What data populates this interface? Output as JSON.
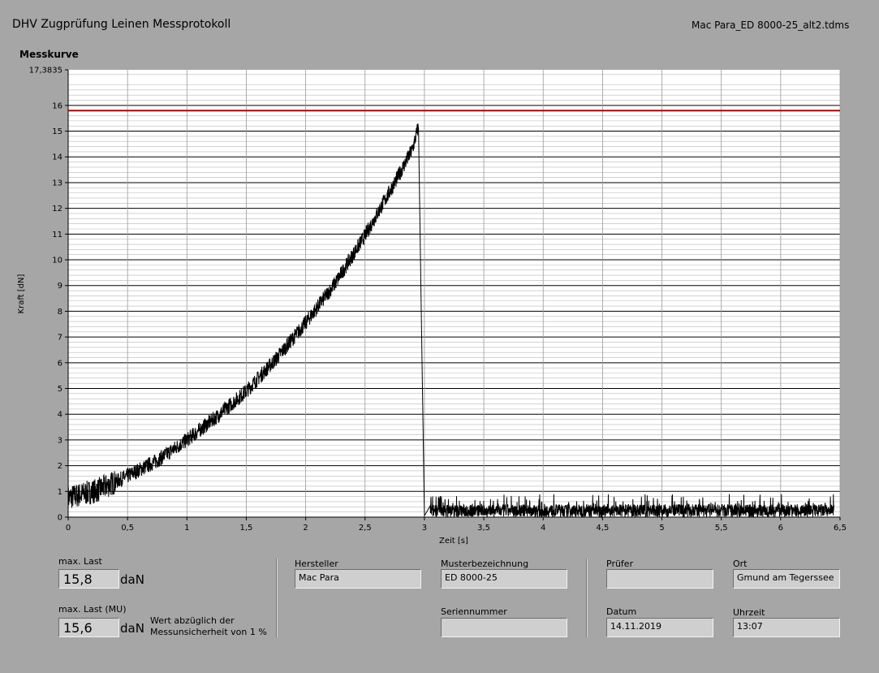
{
  "header": {
    "title": "DHV Zugprüfung Leinen Messprotokoll",
    "file_name": "Mac Para_ED 8000-25_alt2.tdms"
  },
  "chart_title": "Messkurve",
  "chart_data": {
    "type": "line",
    "title": "Messkurve",
    "xlabel": "Zeit [s]",
    "ylabel": "Kraft [dN]",
    "xlim": [
      0,
      6.5
    ],
    "ylim": [
      0,
      17.3835
    ],
    "y_max_label": "17,3835",
    "x_ticks": [
      "0",
      "0,5",
      "1",
      "1,5",
      "2",
      "2,5",
      "3",
      "3,5",
      "4",
      "4,5",
      "5",
      "5,5",
      "6",
      "6,5"
    ],
    "y_ticks": [
      "0",
      "1",
      "2",
      "3",
      "4",
      "5",
      "6",
      "7",
      "8",
      "9",
      "10",
      "11",
      "12",
      "13",
      "14",
      "15",
      "16"
    ],
    "grid": true,
    "series": [
      {
        "color": "#000000",
        "x": [
          0,
          0.25,
          0.5,
          0.75,
          1.0,
          1.25,
          1.5,
          1.75,
          2.0,
          2.25,
          2.5,
          2.75,
          2.9,
          2.95,
          2.98,
          3.0,
          3.05,
          6.45
        ],
        "y": [
          0.75,
          1.05,
          1.6,
          2.2,
          3.0,
          3.9,
          4.9,
          6.15,
          7.55,
          9.1,
          10.95,
          13.0,
          14.3,
          15.2,
          6.0,
          0.05,
          0.45,
          0.45
        ],
        "noise_amplitude_upto_3s": 0.6,
        "noise_band_after_3s": [
          0.0,
          0.9
        ]
      },
      {
        "color": "#b00000",
        "x": [
          0,
          6.5
        ],
        "y": [
          15.8,
          15.8
        ]
      }
    ]
  },
  "fields": {
    "max_last": {
      "label": "max. Last",
      "value": "15,8",
      "unit": "daN"
    },
    "max_last_mu": {
      "label": "max. Last (MU)",
      "value": "15,6",
      "unit": "daN",
      "note_line1": "Wert abzüglich der",
      "note_line2": "Messunsicherheit von 1 %"
    },
    "hersteller": {
      "label": "Hersteller",
      "value": "Mac Para"
    },
    "musterbezeichnung": {
      "label": "Musterbezeichnung",
      "value": "ED 8000-25"
    },
    "seriennummer": {
      "label": "Seriennummer",
      "value": ""
    },
    "pruefer": {
      "label": "Prüfer",
      "value": ""
    },
    "ort": {
      "label": "Ort",
      "value": "Gmund am Tegerssee"
    },
    "datum": {
      "label": "Datum",
      "value": "14.11.2019"
    },
    "uhrzeit": {
      "label": "Uhrzeit",
      "value": "13:07"
    }
  }
}
